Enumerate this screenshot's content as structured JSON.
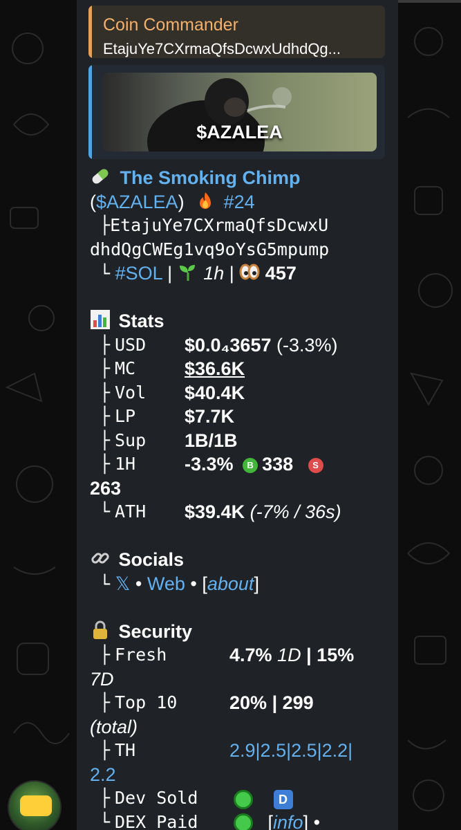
{
  "reply": {
    "title": "Coin Commander",
    "text": "EtajuYe7CXrmaQfsDcwxUdhdQg..."
  },
  "media": {
    "ticker": "$AZALEA"
  },
  "token": {
    "pill_icon": "pill-icon",
    "name": "The Smoking Chimp",
    "paren_open": "(",
    "symbol": "$AZALEA",
    "paren_close": ")",
    "fire_icon": "fire-icon",
    "rank": "#24",
    "tree1": "├",
    "address_line1": "EtajuYe7CXrmaQfsDcwxU",
    "address_line2": "dhdQgCWEg1vq9oYsG5mpump",
    "tree2": "└",
    "chain": "#SOL",
    "sep1": "|",
    "sprout_icon": "seedling-icon",
    "age": "1h",
    "sep2": "|",
    "eyes_icon": "eyes-icon",
    "views": "457"
  },
  "stats": {
    "icon": "bar-chart-icon",
    "heading": "Stats",
    "rows": [
      {
        "tree": "├",
        "label": "USD",
        "value": "$0.0₄3657",
        "extra": "(-3.3%)"
      },
      {
        "tree": "├",
        "label": "MC",
        "value": "$36.6K",
        "extra": ""
      },
      {
        "tree": "├",
        "label": "Vol",
        "value": "$40.4K",
        "extra": ""
      },
      {
        "tree": "├",
        "label": "LP",
        "value": "$7.7K",
        "extra": ""
      },
      {
        "tree": "├",
        "label": "Sup",
        "value": "1B/1B",
        "extra": ""
      }
    ],
    "h1": {
      "tree": "├",
      "label": "1H",
      "change": "-3.3%",
      "buy_badge": "B",
      "buys": "338",
      "sell_badge": "S",
      "sells": "263"
    },
    "ath": {
      "tree": "└",
      "label": "ATH",
      "value": "$39.4K",
      "extra": "(-7% / 36s)"
    }
  },
  "socials": {
    "icon": "link-icon",
    "heading": "Socials",
    "tree": "└",
    "x": "𝕏",
    "bullet1": "•",
    "web": "Web",
    "bullet2": "•",
    "about_open": "[",
    "about": "about",
    "about_close": "]"
  },
  "security": {
    "icon": "lock-icon",
    "heading": "Security",
    "fresh": {
      "tree": "├",
      "label": "Fresh",
      "v1": "4.7%",
      "p1": "1D",
      "sep": "|",
      "v2": "15%",
      "p2": "7D"
    },
    "top10": {
      "tree": "├",
      "label": "Top 10",
      "v1": "20%",
      "sep": "|",
      "v2": "299",
      "p": "(total)"
    },
    "th": {
      "tree": "├",
      "label": "TH",
      "values": "2.9|2.5|2.5|2.2|",
      "last": "2.2"
    },
    "dev_sold": {
      "tree": "├",
      "label": "Dev Sold",
      "badge": "D"
    },
    "dex_paid": {
      "tree": "└",
      "label": "DEX Paid",
      "info_open": "[",
      "info": "info",
      "info_close": "]",
      "bullet": "•"
    }
  },
  "colors": {
    "link": "#64b1f0",
    "reply_accent": "#e1a25a",
    "media_accent": "#4fa3e0",
    "bubble": "#1f2327"
  }
}
